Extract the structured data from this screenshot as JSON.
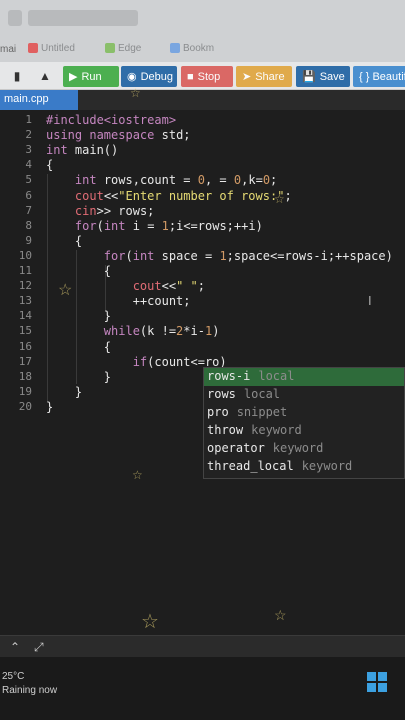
{
  "browser": {
    "tab_partial": "mai",
    "bookmarks": [
      "Untitled",
      "Edge",
      "Bookm"
    ]
  },
  "toolbar": {
    "run_label": "Run",
    "debug_label": "Debug",
    "stop_label": "Stop",
    "share_label": "Share",
    "save_label": "Save",
    "beautify_label": "{ } Beautify"
  },
  "editor": {
    "file_tab": "main.cpp",
    "lines": [
      {
        "n": "1",
        "text": "#include<iostream>"
      },
      {
        "n": "2",
        "text": "using namespace std;"
      },
      {
        "n": "3",
        "text": "int main()"
      },
      {
        "n": "4",
        "text": "{"
      },
      {
        "n": "5",
        "text": "    int rows,count = 0,count1 = 0,k=0;"
      },
      {
        "n": "6",
        "text": "    cout<<\"Enter number of rows:\";"
      },
      {
        "n": "7",
        "text": "    cin>> rows;"
      },
      {
        "n": "8",
        "text": "    for(int i = 1;i<=rows;++i)"
      },
      {
        "n": "9",
        "text": "    {"
      },
      {
        "n": "10",
        "text": "        for(int space = 1;space<=rows-i;++space)"
      },
      {
        "n": "11",
        "text": "        {"
      },
      {
        "n": "12",
        "text": "            cout<<\" \";"
      },
      {
        "n": "13",
        "text": "            ++count;"
      },
      {
        "n": "14",
        "text": "        }"
      },
      {
        "n": "15",
        "text": "        while(k !=2*i-1)"
      },
      {
        "n": "16",
        "text": "        {"
      },
      {
        "n": "17",
        "text": "            if(count<=ro)"
      },
      {
        "n": "18",
        "text": "        }"
      },
      {
        "n": "19",
        "text": "    }"
      },
      {
        "n": "20",
        "text": "}"
      }
    ]
  },
  "autocomplete": {
    "items": [
      {
        "label": "rows-i",
        "kind": "local"
      },
      {
        "label": "rows",
        "kind": "local"
      },
      {
        "label": "pro",
        "kind": "snippet"
      },
      {
        "label": "throw",
        "kind": "keyword"
      },
      {
        "label": "operator",
        "kind": "keyword"
      },
      {
        "label": "thread_local",
        "kind": "keyword"
      }
    ]
  },
  "taskbar": {
    "temperature": "25°C",
    "weather": "Raining now"
  }
}
